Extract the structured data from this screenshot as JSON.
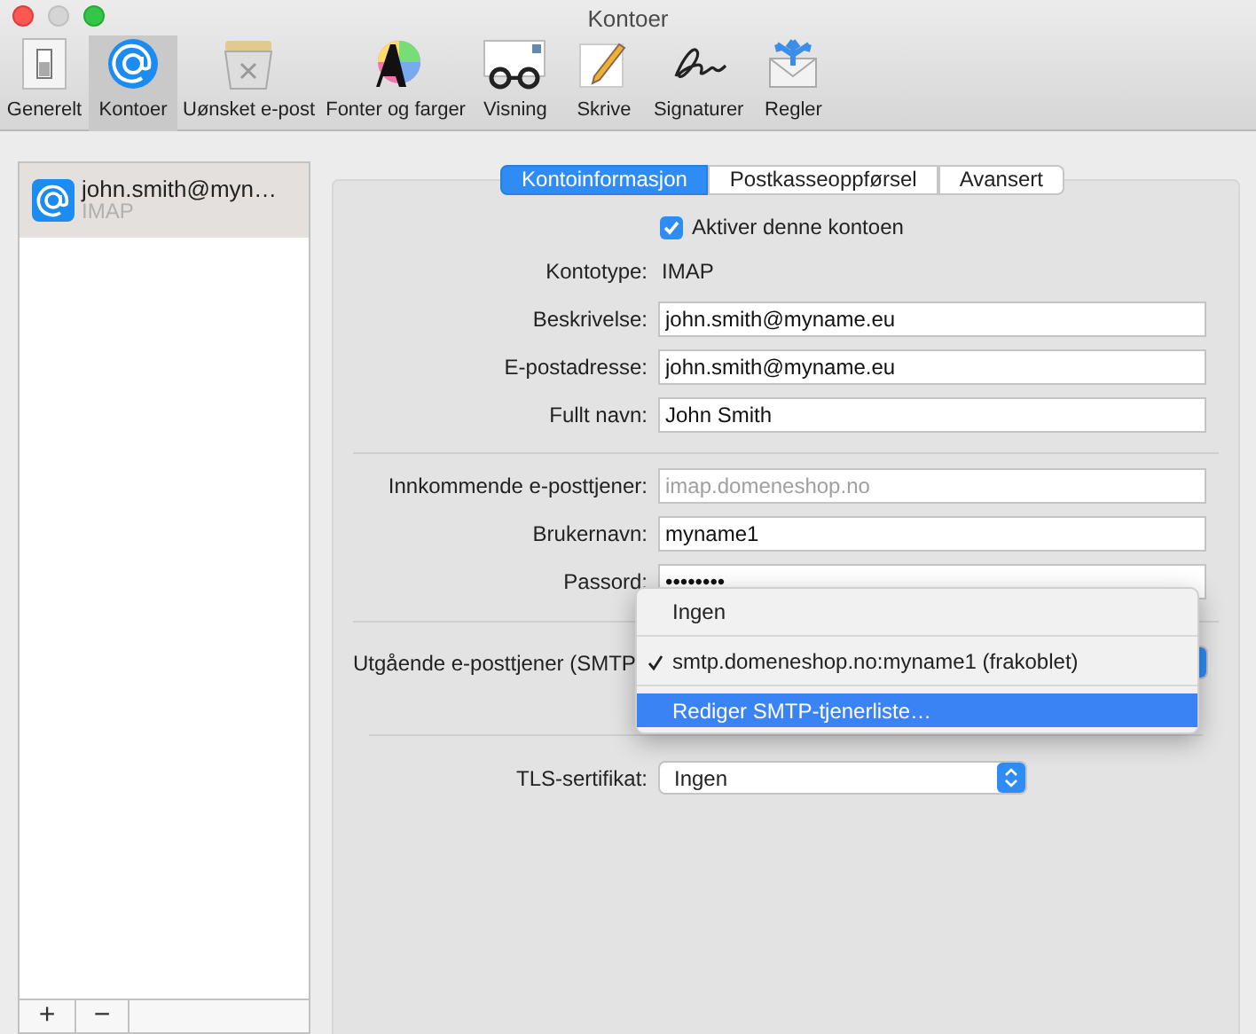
{
  "window": {
    "title": "Kontoer"
  },
  "toolbar": [
    {
      "label": "Generelt",
      "selected": false
    },
    {
      "label": "Kontoer",
      "selected": true
    },
    {
      "label": "Uønsket e-post",
      "selected": false
    },
    {
      "label": "Fonter og farger",
      "selected": false
    },
    {
      "label": "Visning",
      "selected": false
    },
    {
      "label": "Skrive",
      "selected": false
    },
    {
      "label": "Signaturer",
      "selected": false
    },
    {
      "label": "Regler",
      "selected": false
    }
  ],
  "sidebar": {
    "accounts": [
      {
        "name": "john.smith@myn…",
        "type": "IMAP",
        "selected": true
      }
    ],
    "buttons": [
      "+",
      "−"
    ]
  },
  "tabs": [
    {
      "label": "Kontoinformasjon",
      "selected": true
    },
    {
      "label": "Postkasseoppførsel",
      "selected": false
    },
    {
      "label": "Avansert",
      "selected": false
    }
  ],
  "enable_checkbox": {
    "label": "Aktiver denne kontoen",
    "checked": true
  },
  "sections": [
    [
      {
        "kind": "static",
        "label": "Kontotype:",
        "value": "IMAP"
      },
      {
        "kind": "field",
        "label": "Beskrivelse:",
        "value": "john.smith@myname.eu",
        "disabled": false
      },
      {
        "kind": "field",
        "label": "E-postadresse:",
        "value": "john.smith@myname.eu",
        "disabled": false
      },
      {
        "kind": "field",
        "label": "Fullt navn:",
        "value": "John Smith",
        "disabled": false
      }
    ],
    [
      {
        "kind": "field",
        "label": "Innkommende e-posttjener:",
        "value": "imap.domeneshop.no",
        "disabled": true
      },
      {
        "kind": "field",
        "label": "Brukernavn:",
        "value": "myname1",
        "disabled": false
      },
      {
        "kind": "field",
        "label": "Passord:",
        "value": "••••••••",
        "disabled": false
      }
    ],
    [
      {
        "kind": "open-popup",
        "label": "Utgående e-posttjener (SMTP"
      }
    ],
    [
      {
        "kind": "popup",
        "label": "TLS-sertifikat:",
        "value": "Ingen"
      }
    ]
  ],
  "menu": [
    {
      "label": "Ingen",
      "checked": false,
      "selected": false
    },
    {
      "label": "smtp.domeneshop.no:myname1 (frakoblet)",
      "checked": true,
      "selected": false
    },
    {
      "label": "Rediger SMTP-tjenerliste…",
      "checked": false,
      "selected": true
    }
  ]
}
